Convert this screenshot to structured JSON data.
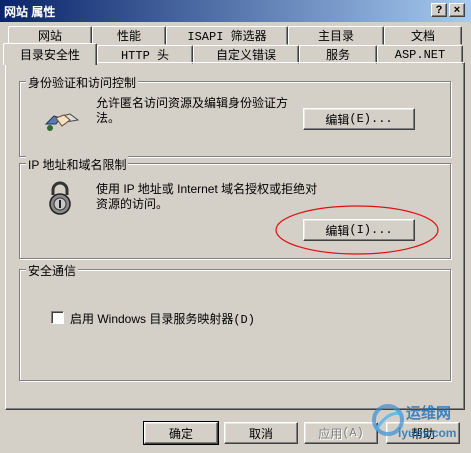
{
  "window": {
    "title": "网站 属性",
    "help_button": "?",
    "close_button": "×"
  },
  "tabs": {
    "row1": [
      "网站",
      "性能",
      "ISAPI 筛选器",
      "主目录",
      "文档"
    ],
    "row2": [
      "目录安全性",
      "HTTP 头",
      "自定义错误",
      "服务",
      "ASP.NET"
    ],
    "active": "目录安全性"
  },
  "auth": {
    "title": "身份验证和访问控制",
    "description": "允许匿名访问资源及编辑身份验证方法。",
    "button_label": "编辑",
    "button_key": "(E)...",
    "icon": "handshake-icon"
  },
  "ip": {
    "title": "IP 地址和域名限制",
    "description": "使用 IP 地址或 Internet 域名授权或拒绝对资源的访问。",
    "button_label": "编辑",
    "button_key": "(I)...",
    "icon": "padlock-icon",
    "highlight_color": "#e01010"
  },
  "secure": {
    "title": "安全通信",
    "checkbox_label": "启用 Windows 目录服务映射器",
    "checkbox_key": "(D)",
    "checked": false
  },
  "footer": {
    "ok": "确定",
    "cancel": "取消",
    "apply": "应用",
    "apply_key": "(A)",
    "help": "帮助"
  },
  "watermark": {
    "text": "运维网",
    "url": "iyunv.com"
  }
}
